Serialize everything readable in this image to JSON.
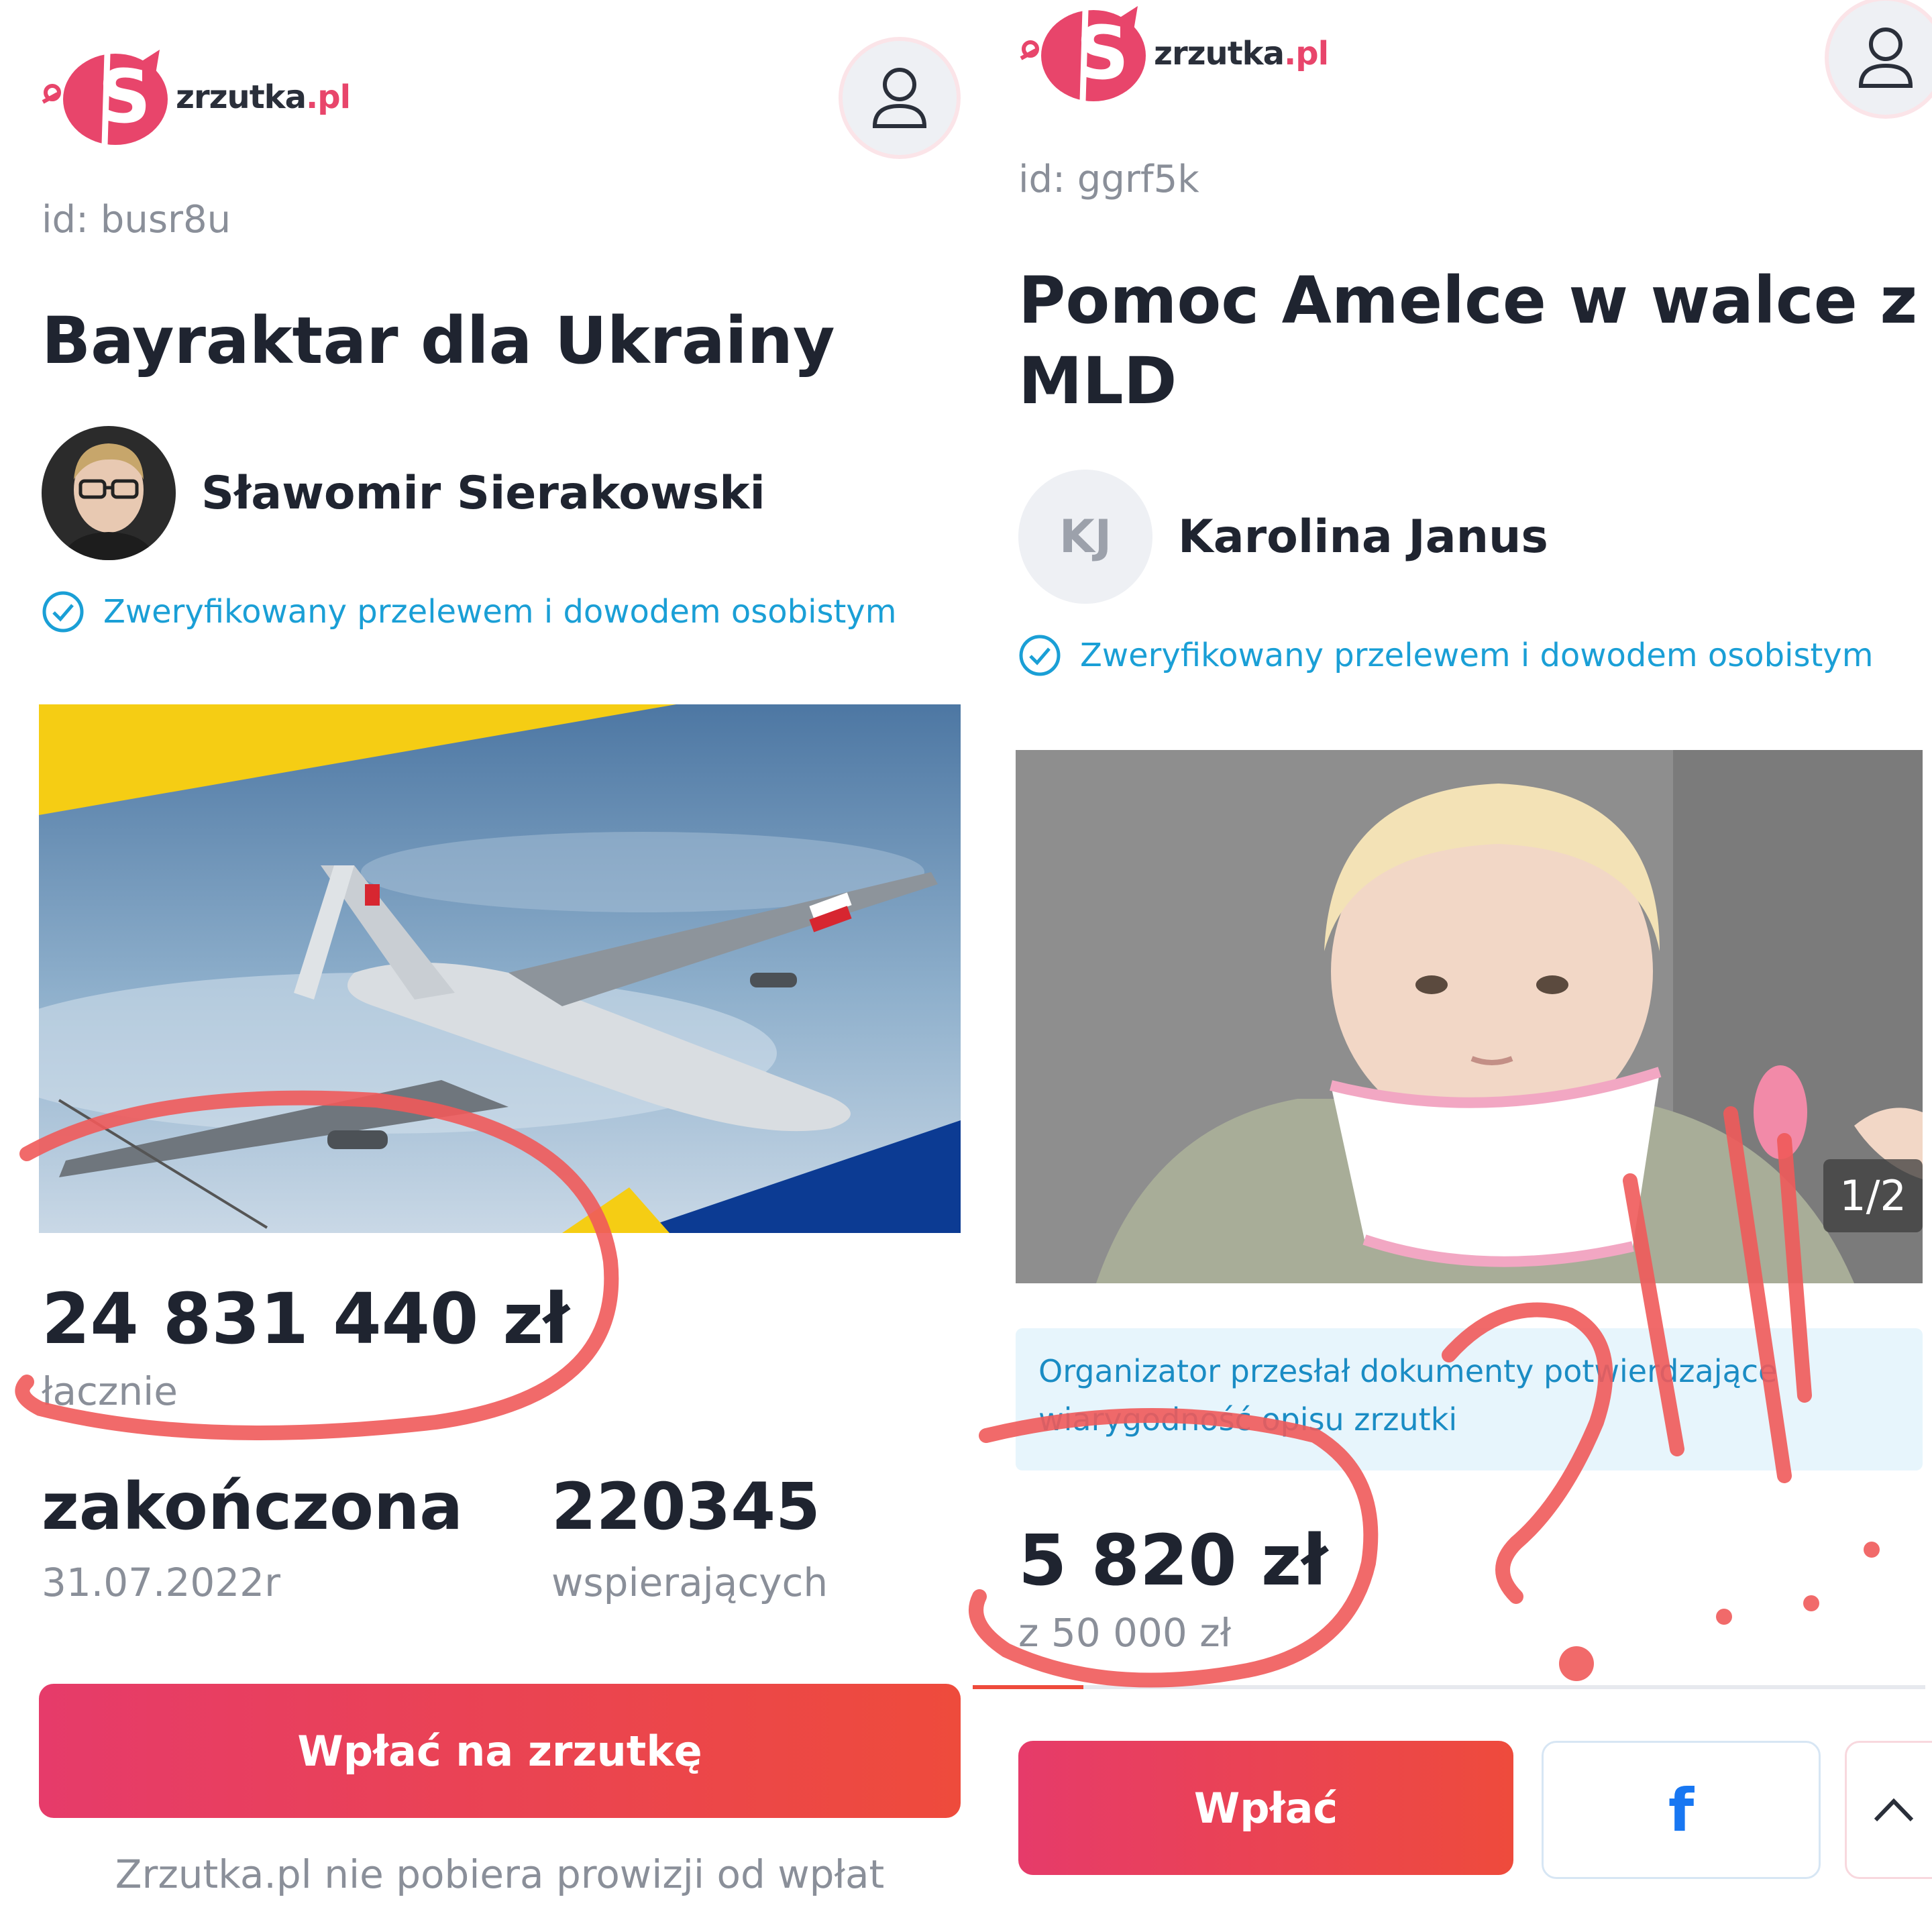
{
  "left": {
    "brand": {
      "name": "zrzutka",
      "tld": ".pl"
    },
    "campaign_id": "id: busr8u",
    "title": "Bayraktar dla Ukrainy",
    "organizer": {
      "name": "Sławomir Sierakowski"
    },
    "verified": "Zweryfikowany przelewem i dowodem osobistym",
    "amount": "24 831 440 zł",
    "amount_label": "łacznie",
    "status": "zakończona",
    "status_date": "31.07.2022r",
    "supporters": "220345",
    "supporters_label": "wspierających",
    "donate_label": "Wpłać na zrzutkę",
    "footnote": "Zrzutka.pl nie pobiera prowizji od wpłat"
  },
  "right": {
    "brand": {
      "name": "zrzutka",
      "tld": ".pl"
    },
    "campaign_id": "id: ggrf5k",
    "title_line1": "Pomoc Amelce w walce z",
    "title_line2": "MLD",
    "organizer": {
      "name": "Karolina Janus",
      "initials": "KJ"
    },
    "verified": "Zweryfikowany przelewem i dowodem osobistym",
    "photo_counter": "1/2",
    "notice_line1": "Organizator przesłał dokumenty potwierdzające",
    "notice_line2": "wiarygodność opisu zrzutki",
    "amount": "5 820 zł",
    "goal": "z 50 000 zł",
    "progress": 0.1164,
    "donate_label": "Wpłać",
    "share_icon": "facebook-icon"
  },
  "colors": {
    "brand": "#e8456b",
    "accent_blue": "#1a9fd6",
    "button_start": "#e63b6a",
    "button_end": "#ee4b3c",
    "annotation": "#f05a5a"
  }
}
